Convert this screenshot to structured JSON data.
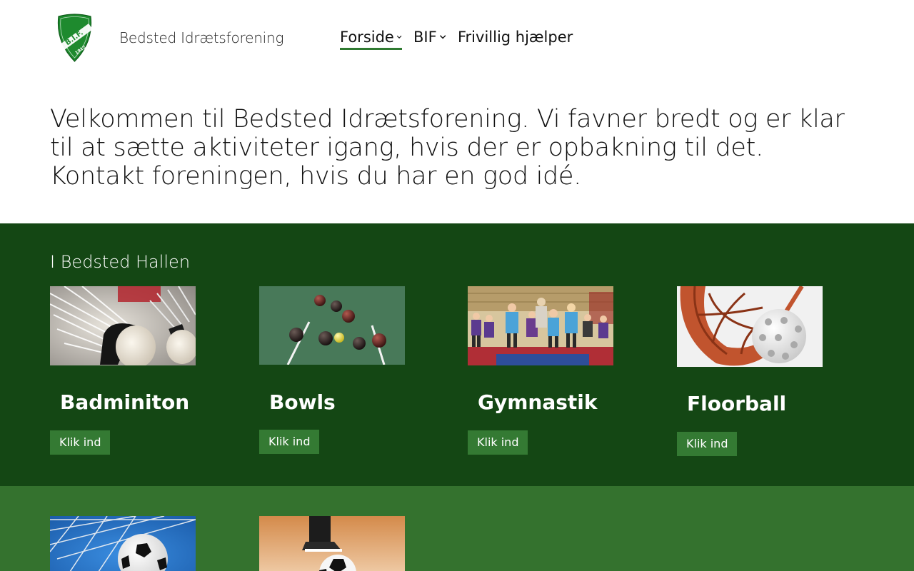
{
  "header": {
    "logo_text": "B.I.F.",
    "logo_year": "1912",
    "site_name": "Bedsted Idrætsforening",
    "nav": [
      {
        "label": "Forside",
        "has_dropdown": true,
        "active": true
      },
      {
        "label": "BIF",
        "has_dropdown": true,
        "active": false
      },
      {
        "label": "Frivillig hjælper",
        "has_dropdown": false,
        "active": false
      }
    ]
  },
  "intro": {
    "text": "Velkommen til Bedsted Idrætsforening. Vi favner bredt og er klar til at sætte aktiviteter igang, hvis der er opbakning til det.  Kontakt foreningen, hvis du har en god idé."
  },
  "hallen": {
    "title": "I Bedsted Hallen",
    "cards": [
      {
        "title": "Badminiton",
        "button": "Klik ind",
        "image": "badminton-shuttlecocks"
      },
      {
        "title": "Bowls",
        "button": "Klik ind",
        "image": "bowls-balls-on-green"
      },
      {
        "title": "Gymnastik",
        "button": "Klik ind",
        "image": "kids-gymnastics"
      },
      {
        "title": "Floorball",
        "button": "Klik ind",
        "image": "floorball-stick-and-ball"
      }
    ]
  },
  "more": {
    "cards": [
      {
        "image": "football-in-goal-net"
      },
      {
        "image": "futsal-foot-on-ball"
      }
    ]
  },
  "colors": {
    "dark_green": "#144714",
    "mid_green": "#34722e",
    "button_green": "#347a33",
    "accent": "#2f7a31"
  }
}
